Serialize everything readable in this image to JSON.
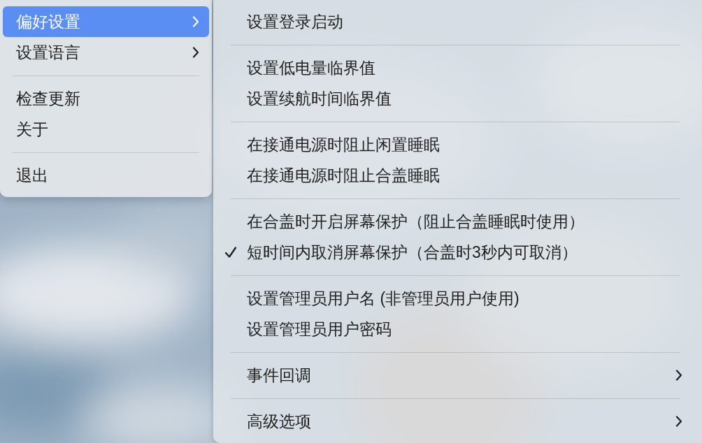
{
  "menu": {
    "items": [
      {
        "kind": "item",
        "label": "偏好设置",
        "selected": true,
        "has_submenu": true
      },
      {
        "kind": "item",
        "label": "设置语言",
        "selected": false,
        "has_submenu": true
      },
      {
        "kind": "separator"
      },
      {
        "kind": "item",
        "label": "检查更新",
        "selected": false,
        "has_submenu": false
      },
      {
        "kind": "item",
        "label": "关于",
        "selected": false,
        "has_submenu": false
      },
      {
        "kind": "separator"
      },
      {
        "kind": "item",
        "label": "退出",
        "selected": false,
        "has_submenu": false
      }
    ]
  },
  "submenu": {
    "items": [
      {
        "kind": "item",
        "label": "设置登录启动",
        "checked": false,
        "has_submenu": false
      },
      {
        "kind": "separator"
      },
      {
        "kind": "item",
        "label": "设置低电量临界值",
        "checked": false,
        "has_submenu": false
      },
      {
        "kind": "item",
        "label": "设置续航时间临界值",
        "checked": false,
        "has_submenu": false
      },
      {
        "kind": "separator"
      },
      {
        "kind": "item",
        "label": "在接通电源时阻止闲置睡眠",
        "checked": false,
        "has_submenu": false
      },
      {
        "kind": "item",
        "label": "在接通电源时阻止合盖睡眠",
        "checked": false,
        "has_submenu": false
      },
      {
        "kind": "separator"
      },
      {
        "kind": "item",
        "label": "在合盖时开启屏幕保护（阻止合盖睡眠时使用）",
        "checked": false,
        "has_submenu": false
      },
      {
        "kind": "item",
        "label": "短时间内取消屏幕保护（合盖时3秒内可取消）",
        "checked": true,
        "has_submenu": false
      },
      {
        "kind": "separator"
      },
      {
        "kind": "item",
        "label": "设置管理员用户名 (非管理员用户使用)",
        "checked": false,
        "has_submenu": false
      },
      {
        "kind": "item",
        "label": "设置管理员用户密码",
        "checked": false,
        "has_submenu": false
      },
      {
        "kind": "separator"
      },
      {
        "kind": "item",
        "label": "事件回调",
        "checked": false,
        "has_submenu": true
      },
      {
        "kind": "separator"
      },
      {
        "kind": "item",
        "label": "高级选项",
        "checked": false,
        "has_submenu": true
      }
    ]
  }
}
